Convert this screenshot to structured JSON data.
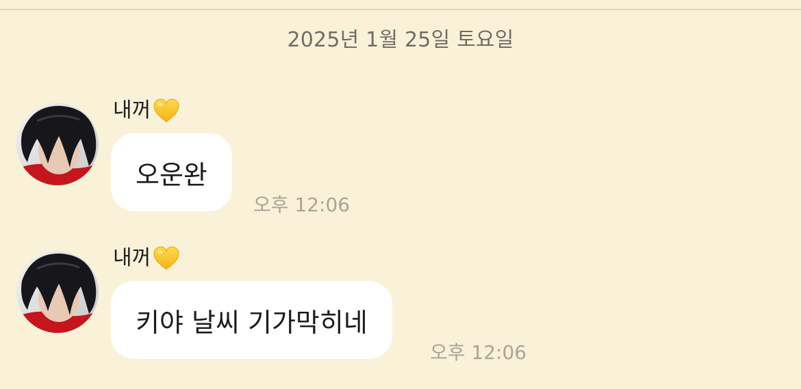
{
  "date_separator": "2025년 1월 25일 토요일",
  "messages": [
    {
      "sender": "내꺼",
      "sender_emoji": "yellow-heart-icon",
      "text": "오운완",
      "time": "오후 12:06"
    },
    {
      "sender": "내꺼",
      "sender_emoji": "yellow-heart-icon",
      "text": "키야 날씨 기가막히네",
      "time": "오후 12:06"
    }
  ],
  "colors": {
    "chat_background": "#faf2d8",
    "bubble_background": "#ffffff",
    "timestamp_text": "#a8a397",
    "date_text": "#6f6c66",
    "heart": "#f8c72b"
  }
}
